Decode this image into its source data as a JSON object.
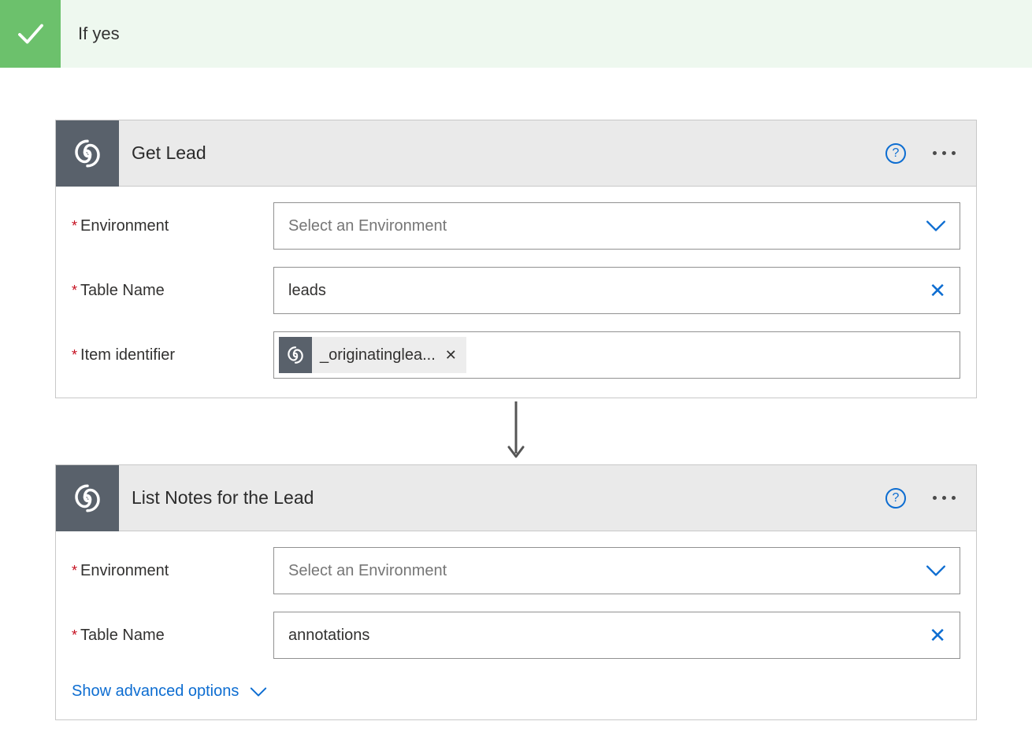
{
  "condition": {
    "title": "If yes"
  },
  "actions": [
    {
      "title": "Get Lead",
      "fields": {
        "environment": {
          "label": "Environment",
          "placeholder": "Select an Environment",
          "value": ""
        },
        "table_name": {
          "label": "Table Name",
          "value": "leads"
        },
        "item_identifier": {
          "label": "Item identifier",
          "token": "_originatinglea..."
        }
      }
    },
    {
      "title": "List Notes for the Lead",
      "fields": {
        "environment": {
          "label": "Environment",
          "placeholder": "Select an Environment",
          "value": ""
        },
        "table_name": {
          "label": "Table Name",
          "value": "annotations"
        }
      },
      "advanced_label": "Show advanced options"
    }
  ]
}
